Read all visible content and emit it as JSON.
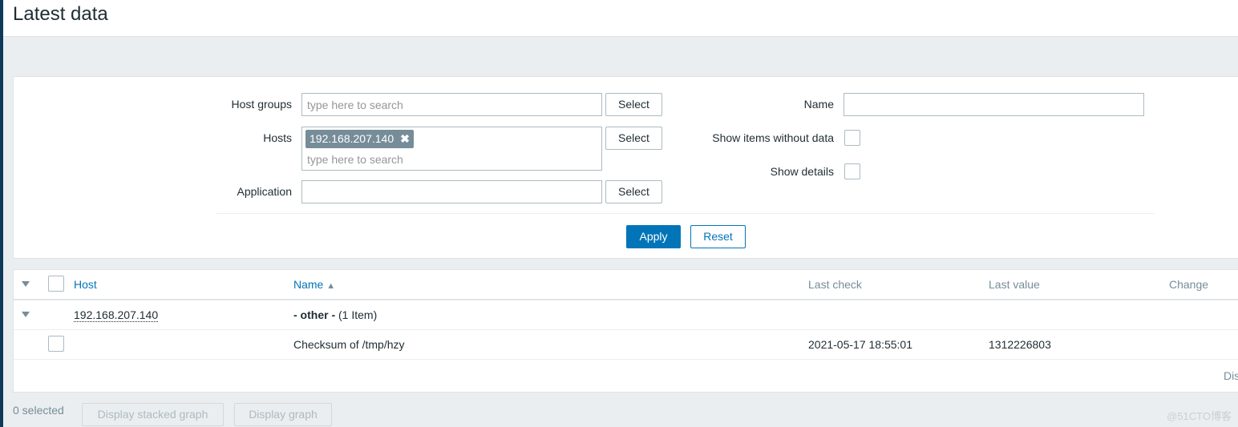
{
  "header": {
    "title": "Latest data"
  },
  "filter": {
    "host_groups": {
      "label": "Host groups",
      "placeholder": "type here to search",
      "select": "Select"
    },
    "hosts": {
      "label": "Hosts",
      "tags": [
        "192.168.207.140"
      ],
      "placeholder": "type here to search",
      "select": "Select",
      "remove_icon": "✖"
    },
    "application": {
      "label": "Application",
      "value": "",
      "select": "Select"
    },
    "name": {
      "label": "Name",
      "value": ""
    },
    "show_without_data": {
      "label": "Show items without data",
      "checked": false
    },
    "show_details": {
      "label": "Show details",
      "checked": false
    },
    "apply": "Apply",
    "reset": "Reset"
  },
  "table": {
    "columns": {
      "host": "Host",
      "name": "Name",
      "last_check": "Last check",
      "last_value": "Last value",
      "change": "Change"
    },
    "sort_icon": "▲",
    "group": {
      "host": "192.168.207.140",
      "name_bold": "- other -",
      "count": "(1 Item)"
    },
    "rows": [
      {
        "name": "Checksum of /tmp/hzy",
        "last_check": "2021-05-17 18:55:01",
        "last_value": "1312226803",
        "change": ""
      }
    ],
    "footer_partial": "Dis"
  },
  "footer": {
    "selected": "0 selected",
    "stacked": "Display stacked graph",
    "graph": "Display graph"
  },
  "watermark": "@51CTO博客",
  "colors": {
    "accent": "#0275b8",
    "tag": "#768d99"
  }
}
